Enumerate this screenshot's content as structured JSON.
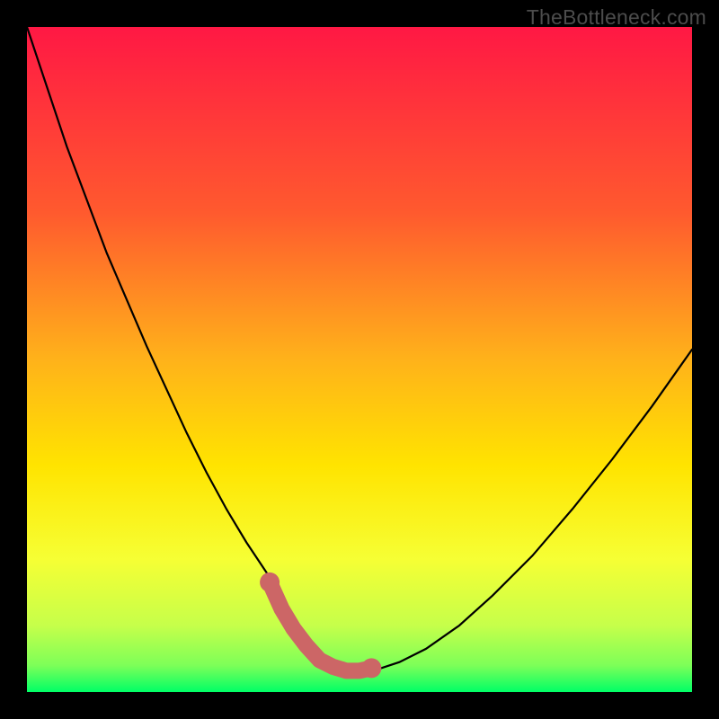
{
  "watermark": "TheBottleneck.com",
  "colors": {
    "background": "#000000",
    "gradient_top": "#ff1844",
    "gradient_upper_mid": "#ff7f27",
    "gradient_mid": "#ffe400",
    "gradient_lower": "#d8ff3a",
    "gradient_bottom": "#00ff66",
    "curve": "#000000",
    "marker": "#cc6666"
  },
  "chart_data": {
    "type": "line",
    "title": "",
    "xlabel": "",
    "ylabel": "",
    "xlim": [
      0,
      100
    ],
    "ylim": [
      0,
      100
    ],
    "series": [
      {
        "name": "bottleneck-curve",
        "x": [
          0,
          3,
          6,
          9,
          12,
          15,
          18,
          21,
          24,
          27,
          30,
          33,
          36,
          38,
          39.5,
          41,
          42.5,
          44,
          46,
          48,
          50,
          53,
          56,
          60,
          65,
          70,
          76,
          82,
          88,
          94,
          100
        ],
        "y": [
          100,
          91,
          82,
          74,
          66,
          59,
          52,
          45.5,
          39,
          33,
          27.5,
          22.5,
          18,
          14,
          11,
          8,
          6,
          4.5,
          3.5,
          3,
          3,
          3.5,
          4.5,
          6.5,
          10,
          14.5,
          20.5,
          27.5,
          35,
          43,
          51.5
        ]
      },
      {
        "name": "marker-segment",
        "x": [
          36.5,
          38.3,
          40.1,
          42.0,
          44.0,
          46.0,
          48.0,
          50.0,
          51.8
        ],
        "y": [
          16.5,
          12.5,
          9.5,
          7.0,
          4.8,
          3.8,
          3.2,
          3.2,
          3.6
        ]
      }
    ]
  }
}
